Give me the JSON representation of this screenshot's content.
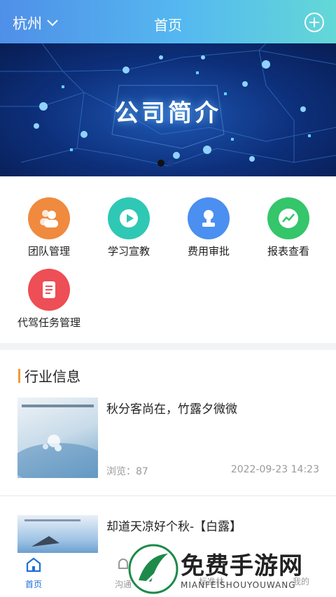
{
  "header": {
    "city": "杭州",
    "title": "首页"
  },
  "banner": {
    "title": "公司简介"
  },
  "grid": [
    {
      "label": "团队管理",
      "color": "#f08a3e",
      "icon": "team-icon"
    },
    {
      "label": "学习宣教",
      "color": "#2fc8b4",
      "icon": "play-icon"
    },
    {
      "label": "费用审批",
      "color": "#4b8ff0",
      "icon": "stamp-icon"
    },
    {
      "label": "报表查看",
      "color": "#35c56a",
      "icon": "chart-line-icon"
    },
    {
      "label": "代驾任务管理",
      "color": "#ee4e55",
      "icon": "document-icon"
    }
  ],
  "news": {
    "section_title": "行业信息",
    "items": [
      {
        "title": "秋分客尚在，竹露夕微微",
        "views": "浏览：87",
        "date": "2022-09-23 14:23"
      },
      {
        "title": "却道天凉好个秋-【白露】",
        "views": "",
        "date": ""
      }
    ]
  },
  "tabbar": [
    {
      "label": "首页",
      "active": true
    },
    {
      "label": "沟通"
    },
    {
      "label": "标准林"
    },
    {
      "label": "我的"
    }
  ],
  "watermark": {
    "text": "免费手游网",
    "sub": "MIANFEISHOUYOUWANG"
  },
  "colors": {
    "accent": "#1f6fd6",
    "section_bar": "#f29a3a"
  }
}
